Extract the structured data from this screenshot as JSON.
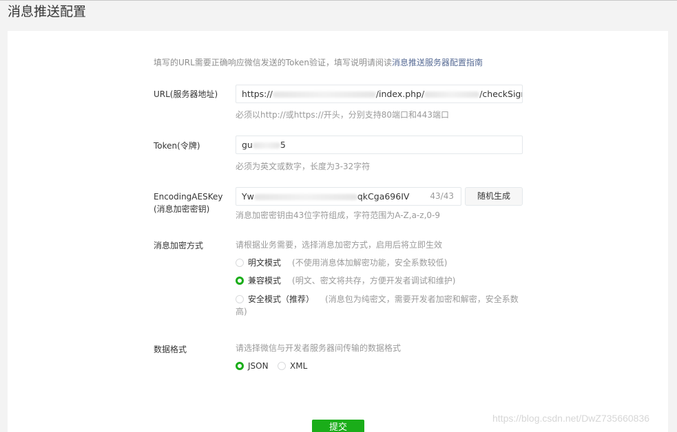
{
  "page": {
    "title": "消息推送配置"
  },
  "notice": {
    "text": "填写的URL需要正确响应微信发送的Token验证，填写说明请阅读",
    "link": "消息推送服务器配置指南"
  },
  "url_field": {
    "label": "URL(服务器地址)",
    "value_prefix": "https://",
    "value_mid": "/index.php/",
    "value_suffix": "/checkSignature",
    "hint": "必须以http://或https://开头，分别支持80端口和443端口"
  },
  "token_field": {
    "label": "Token(令牌)",
    "value_prefix": "gu",
    "value_suffix": "5",
    "hint": "必须为英文或数字，长度为3-32字符"
  },
  "aes_field": {
    "label_line1": "EncodingAESKey",
    "label_line2": "(消息加密密钥)",
    "value_prefix": "Yw",
    "value_suffix": "qkCga696IV",
    "counter": "43/43",
    "generate_button": "随机生成",
    "hint": "消息加密密钥由43位字符组成，字符范围为A-Z,a-z,0-9"
  },
  "encryption": {
    "label": "消息加密方式",
    "hint": "请根据业务需要，选择消息加密方式，启用后将立即生效",
    "options": [
      {
        "label": "明文模式",
        "desc": "(不使用消息体加解密功能，安全系数较低)",
        "checked": false
      },
      {
        "label": "兼容模式",
        "desc": "(明文、密文将共存，方便开发者调试和维护)",
        "checked": true
      },
      {
        "label": "安全模式（推荐）",
        "desc": "(消息包为纯密文，需要开发者加密和解密，安全系数",
        "desc_line2": "高)",
        "checked": false
      }
    ]
  },
  "data_format": {
    "label": "数据格式",
    "hint": "请选择微信与开发者服务器间传输的数据格式",
    "options": [
      {
        "label": "JSON",
        "checked": true
      },
      {
        "label": "XML",
        "checked": false
      }
    ]
  },
  "submit": {
    "label": "提交"
  },
  "watermark": "https://blog.csdn.net/DwZ735660836",
  "colors": {
    "accent": "#1aad19",
    "link": "#576b95"
  }
}
